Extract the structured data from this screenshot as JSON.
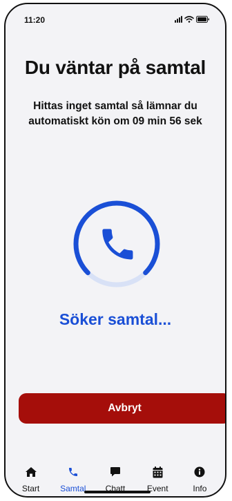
{
  "status_bar": {
    "time": "11:20"
  },
  "header": {
    "title": "Du väntar på samtal",
    "subtitle": "Hittas inget samtal så lämnar du automatiskt kön om 09 min 56 sek"
  },
  "main": {
    "spinner_icon": "phone-icon",
    "search_status": "Söker samtal...",
    "cancel_label": "Avbryt"
  },
  "colors": {
    "accent": "#1a4fd6",
    "accent_light": "#d8e1f6",
    "danger": "#a50e0a",
    "background": "#f3f3f6"
  },
  "tab_bar": {
    "active": "Samtal",
    "tabs": [
      {
        "label": "Start",
        "icon": "home-icon"
      },
      {
        "label": "Samtal",
        "icon": "phone-icon"
      },
      {
        "label": "Chatt",
        "icon": "chat-bubble-icon"
      },
      {
        "label": "Event",
        "icon": "calendar-icon"
      },
      {
        "label": "Info",
        "icon": "info-icon"
      }
    ]
  }
}
